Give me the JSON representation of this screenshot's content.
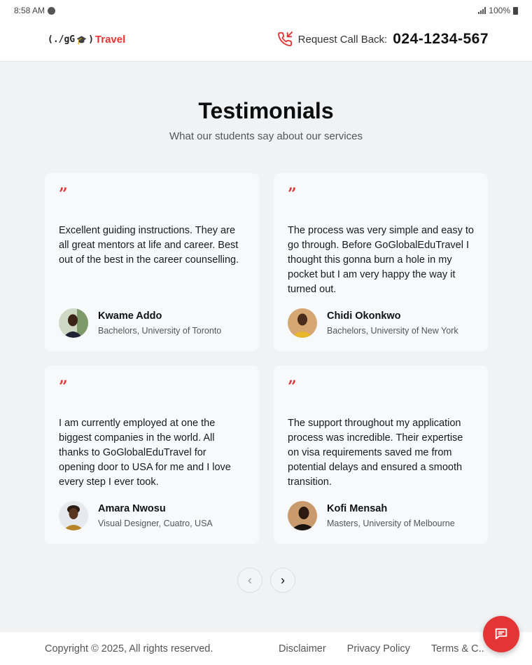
{
  "status_bar": {
    "time": "8:58 AM",
    "battery": "100%"
  },
  "header": {
    "logo_prefix": "(./gG",
    "logo_suffix": ")",
    "logo_brand": "Travel",
    "callback_label": "Request Call Back:",
    "phone": "024-1234-567"
  },
  "section": {
    "title": "Testimonials",
    "subtitle": "What our students say about our services"
  },
  "testimonials": [
    {
      "quote_mark": "”",
      "text": "Excellent guiding instructions. They are all great mentors at life and career. Best out of the best in the career counselling.",
      "name": "Kwame Addo",
      "role": "Bachelors, University of Toronto"
    },
    {
      "quote_mark": "”",
      "text": "The process was very simple and easy to go through. Before GoGlobalEduTravel I thought this gonna burn a hole in my pocket but I am very happy the way it turned out.",
      "name": "Chidi Okonkwo",
      "role": "Bachelors, University of New York"
    },
    {
      "quote_mark": "”",
      "text": "I am currently employed at one the biggest companies in the world. All thanks to GoGlobalEduTravel for opening door to USA for me and I love every step I ever took.",
      "name": "Amara Nwosu",
      "role": "Visual Designer, Cuatro, USA"
    },
    {
      "quote_mark": "”",
      "text": "The support throughout my application process was incredible. Their expertise on visa requirements saved me from potential delays and ensured a smooth transition.",
      "name": "Kofi Mensah",
      "role": "Masters, University of Melbourne"
    }
  ],
  "pagination": {
    "prev_icon": "chevron-left-icon",
    "next_icon": "chevron-right-icon",
    "prev_glyph": "‹",
    "next_glyph": "›"
  },
  "footer": {
    "copyright": "Copyright © 2025, All rights reserved.",
    "links": [
      "Disclaimer",
      "Privacy Policy",
      "Terms & C.."
    ]
  },
  "colors": {
    "accent": "#e43535",
    "background": "#f1f2f3",
    "card": "#f8f9fb"
  }
}
